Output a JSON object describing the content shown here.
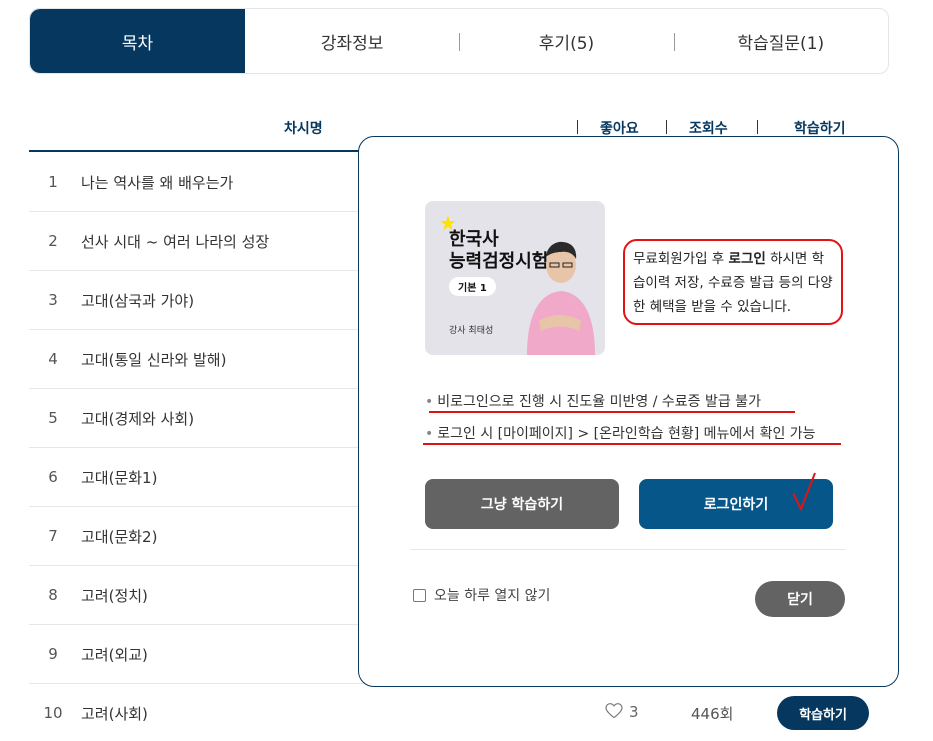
{
  "tabs": [
    {
      "label": "목차",
      "active": true
    },
    {
      "label": "강좌정보",
      "active": false
    },
    {
      "label": "후기(5)",
      "active": false
    },
    {
      "label": "학습질문(1)",
      "active": false
    }
  ],
  "table": {
    "headers": {
      "title": "차시명",
      "like": "좋아요",
      "views": "조회수",
      "study": "학습하기"
    },
    "rows": [
      {
        "num": "1",
        "title": "나는 역사를 왜 배우는가"
      },
      {
        "num": "2",
        "title": "선사 시대 ~ 여러 나라의 성장"
      },
      {
        "num": "3",
        "title": "고대(삼국과 가야)"
      },
      {
        "num": "4",
        "title": "고대(통일 신라와 발해)"
      },
      {
        "num": "5",
        "title": "고대(경제와 사회)"
      },
      {
        "num": "6",
        "title": "고대(문화1)"
      },
      {
        "num": "7",
        "title": "고대(문화2)"
      },
      {
        "num": "8",
        "title": "고려(정치)"
      },
      {
        "num": "9",
        "title": "고려(외교)"
      },
      {
        "num": "10",
        "title": "고려(사회)",
        "likes": "3",
        "views": "446회",
        "button": "학습하기"
      }
    ]
  },
  "modal": {
    "thumbnail": {
      "title_line1": "한국사",
      "title_line2": "능력검정시험",
      "badge": "기본 1",
      "teacher": "강사 최태성"
    },
    "notice": {
      "part1": "무료회원가입 후 ",
      "bold": "로그인",
      "part2": " 하시면 학습이력 저장, 수료증 발급 등의 다양한 혜택을 받을 수 있습니다."
    },
    "bullets": [
      "비로그인으로 진행 시 진도율 미반영 / 수료증 발급 불가",
      "로그인 시 [마이페이지] > [온라인학습 현황] 메뉴에서 확인 가능"
    ],
    "btn_plain": "그냥 학습하기",
    "btn_login": "로그인하기",
    "checkbox_label": "오늘 하루 열지 않기",
    "btn_close": "닫기"
  },
  "colors": {
    "navy": "#06385f",
    "login_blue": "#06568a",
    "gray_button": "#636363",
    "annotation_red": "#e01414"
  }
}
